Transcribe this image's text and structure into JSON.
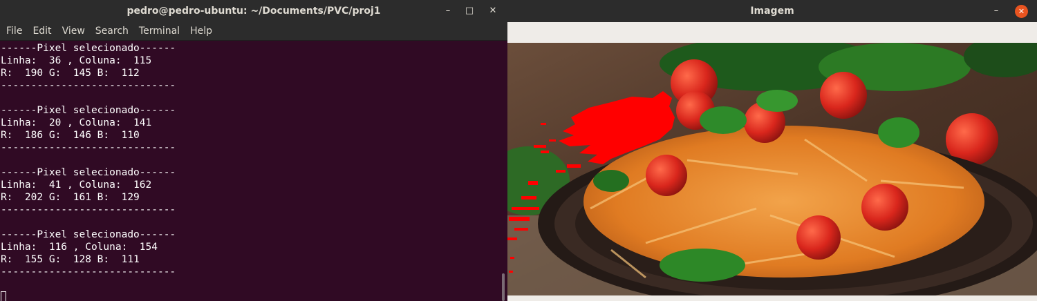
{
  "terminal": {
    "title": "pedro@pedro-ubuntu: ~/Documents/PVC/proj1",
    "controls": {
      "minimize": "–",
      "maximize": "□",
      "close": "✕"
    },
    "menu": [
      "File",
      "Edit",
      "View",
      "Search",
      "Terminal",
      "Help"
    ],
    "lines": [
      "------Pixel selecionado------",
      "Linha:  36 , Coluna:  115",
      "R:  190 G:  145 B:  112",
      "-----------------------------",
      "",
      "------Pixel selecionado------",
      "Linha:  20 , Coluna:  141",
      "R:  186 G:  146 B:  110",
      "-----------------------------",
      "",
      "------Pixel selecionado------",
      "Linha:  41 , Coluna:  162",
      "R:  202 G:  161 B:  129",
      "-----------------------------",
      "",
      "------Pixel selecionado------",
      "Linha:  116 , Coluna:  154",
      "R:  155 G:  128 B:  111",
      "-----------------------------",
      "",
      ""
    ]
  },
  "viewer": {
    "title": "Imagem",
    "controls": {
      "minimize": "–",
      "close": "✕"
    },
    "image_description_icon": "pasta-photo",
    "highlight_color": "#ff0000"
  },
  "colors": {
    "terminal_bg": "#300a24",
    "titlebar_bg": "#2c2c2c",
    "close_accent": "#e95420"
  }
}
